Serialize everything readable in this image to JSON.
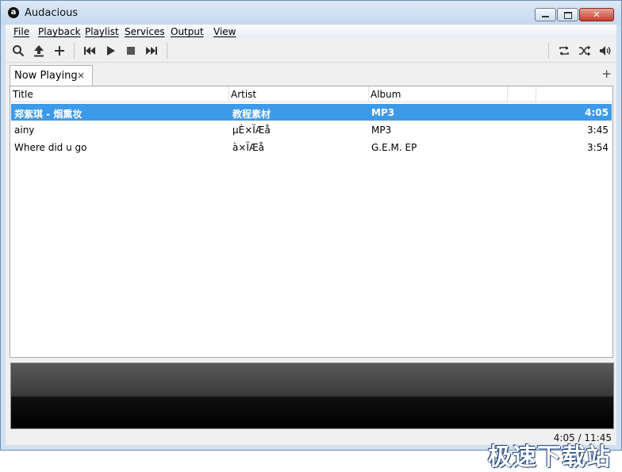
{
  "window": {
    "title": "Audacious",
    "logo_glyph": "a",
    "close_glyph": "✕"
  },
  "menu": [
    "File",
    "Playback",
    "Playlist",
    "Services",
    "Output",
    "View"
  ],
  "toolbar": {
    "icons": [
      "search-icon",
      "open-icon",
      "add-icon",
      "previous-icon",
      "play-icon",
      "stop-icon",
      "next-icon",
      "repeat-icon",
      "shuffle-icon",
      "volume-icon"
    ]
  },
  "tabs": [
    {
      "label": "Now Playing",
      "close": "×"
    }
  ],
  "add_tab": "+",
  "playlist": {
    "columns": [
      "Title",
      "Artist",
      "Album"
    ],
    "rows": [
      {
        "title": "郑紫琪 - 烟熏妆",
        "artist": "教程素材",
        "album": "MP3",
        "length": "4:05",
        "selected": true
      },
      {
        "title": "ainy",
        "artist": "µÈ×ÏÆå",
        "album": "MP3",
        "length": "3:45",
        "selected": false
      },
      {
        "title": "Where did u go",
        "artist": "à×ÏÆå",
        "album": "G.E.M. EP",
        "length": "3:54",
        "selected": false
      }
    ]
  },
  "status": {
    "time": "4:05 / 11:45"
  },
  "watermark": "极速下载站",
  "colors": {
    "selection": "#3d9ae8",
    "titlebar": "#c5d8ee"
  }
}
